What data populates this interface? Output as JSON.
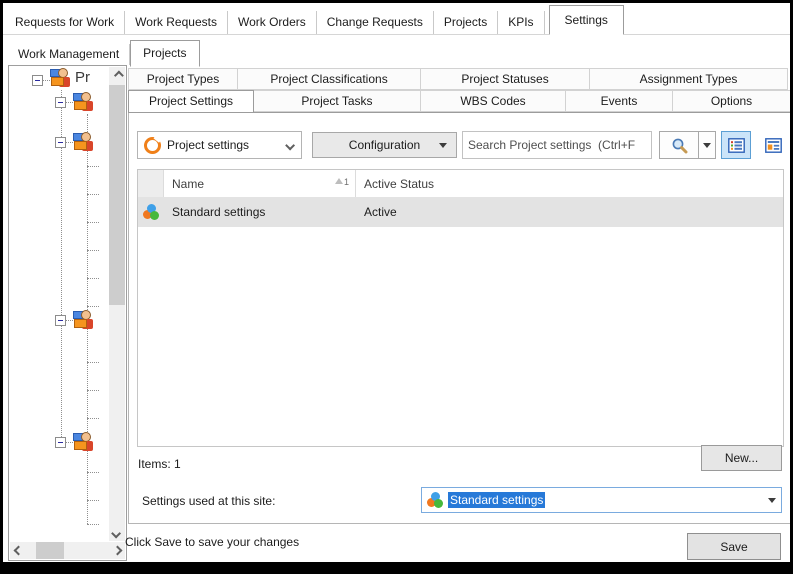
{
  "colors": {
    "tab-border": "#9c9c9c",
    "selection-blue": "#2779d8",
    "row-selected": "#e3e3e3",
    "icon-orange": "#f08019",
    "ball-blue": "#3fa0e8",
    "ball-orange": "#f07820",
    "ball-green": "#46b83c",
    "view-accent": "#2e62b8"
  },
  "top_tabs": [
    "Requests for Work",
    "Work Requests",
    "Work Orders",
    "Change Requests",
    "Projects",
    "KPIs",
    "Settings"
  ],
  "sub_tabs": [
    "Work Management",
    "Projects"
  ],
  "tree": {
    "root_label": "Pr"
  },
  "panel": {
    "tabs_row1": [
      "Project Types",
      "Project Classifications",
      "Project Statuses",
      "Assignment Types"
    ],
    "tabs_row2": [
      "Project Settings",
      "Project Tasks",
      "WBS Codes",
      "Events",
      "Options"
    ],
    "toolbar": {
      "category_combo_value": "Project settings",
      "configuration_button": "Configuration",
      "search_placeholder": "Search Project settings  (Ctrl+F"
    },
    "table": {
      "columns": [
        "Name",
        "Active Status"
      ],
      "sort_number": "1",
      "rows": [
        {
          "name": "Standard settings",
          "status": "Active"
        }
      ]
    },
    "items_label": "Items: 1",
    "new_button": "New...",
    "site_row": {
      "label": "Settings used at this site:",
      "value": "Standard settings"
    },
    "footer": {
      "hint": "Click Save to save your changes",
      "save_button": "Save"
    }
  }
}
